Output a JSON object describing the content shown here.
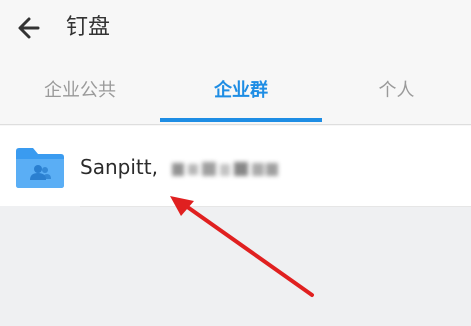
{
  "header": {
    "title": "钉盘",
    "back_icon": "arrow-left-icon"
  },
  "tabs": [
    {
      "label": "企业公共",
      "active": false
    },
    {
      "label": "企业群",
      "active": true
    },
    {
      "label": "个人",
      "active": false
    }
  ],
  "list": {
    "items": [
      {
        "name": "Sanpitt,",
        "icon": "group-folder-icon"
      }
    ]
  },
  "colors": {
    "accent": "#1e8de4",
    "folder": "#3a9bf0",
    "annotation_arrow": "#e02020"
  }
}
